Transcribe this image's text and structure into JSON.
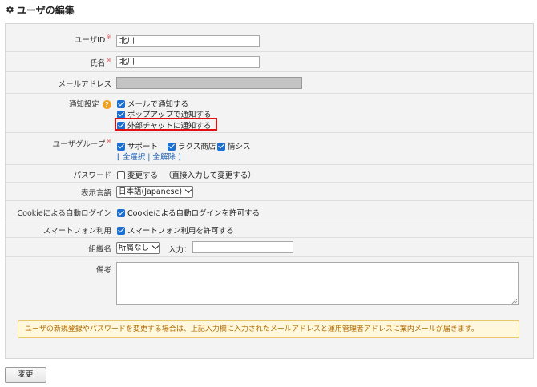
{
  "page": {
    "title": "ユーザの編集",
    "title_icon": "gear-icon"
  },
  "form": {
    "user_id": {
      "label": "ユーザID",
      "required_mark": "※",
      "value": "北川"
    },
    "name": {
      "label": "氏名",
      "required_mark": "※",
      "value": "北川"
    },
    "email": {
      "label": "メールアドレス",
      "value": ""
    },
    "notify": {
      "label": "通知設定",
      "help_glyph": "?",
      "options": [
        {
          "label": "メールで通知する",
          "checked": true
        },
        {
          "label": "ポップアップで通知する",
          "checked": true
        },
        {
          "label": "外部チャットに通知する",
          "checked": true
        }
      ]
    },
    "groups": {
      "label": "ユーザグループ",
      "required_mark": "※",
      "options": [
        {
          "label": "サポート",
          "checked": true
        },
        {
          "label": "ラクス商店",
          "checked": true
        },
        {
          "label": "情シス",
          "checked": true
        }
      ],
      "bracket_open": "[",
      "select_all": "全選択",
      "separator": "|",
      "deselect_all": "全解除",
      "bracket_close": "]"
    },
    "password": {
      "label": "パスワード",
      "option": "変更する",
      "note": "（直接入力して変更する）",
      "checked": false
    },
    "language": {
      "label": "表示言語",
      "selected": "日本語(Japanese)"
    },
    "cookie": {
      "label": "Cookieによる自動ログイン",
      "option": "Cookieによる自動ログインを許可する",
      "checked": true
    },
    "smartphone": {
      "label": "スマートフォン利用",
      "option": "スマートフォン利用を許可する",
      "checked": true
    },
    "org": {
      "label": "組織名",
      "selected": "所属なし",
      "input_label": "入力：",
      "input_value": ""
    },
    "remarks": {
      "label": "備考",
      "value": ""
    }
  },
  "notice": "ユーザの新規登録やパスワードを変更する場合は、上記入力欄に入力されたメールアドレスと運用管理者アドレスに案内メールが届きます。",
  "submit_label": "変更",
  "colors": {
    "checkbox": "#1a6fd1",
    "highlight": "#e01010",
    "notice_bg": "#fff8dc",
    "notice_text": "#b06a00",
    "link": "#1a5fb4"
  }
}
